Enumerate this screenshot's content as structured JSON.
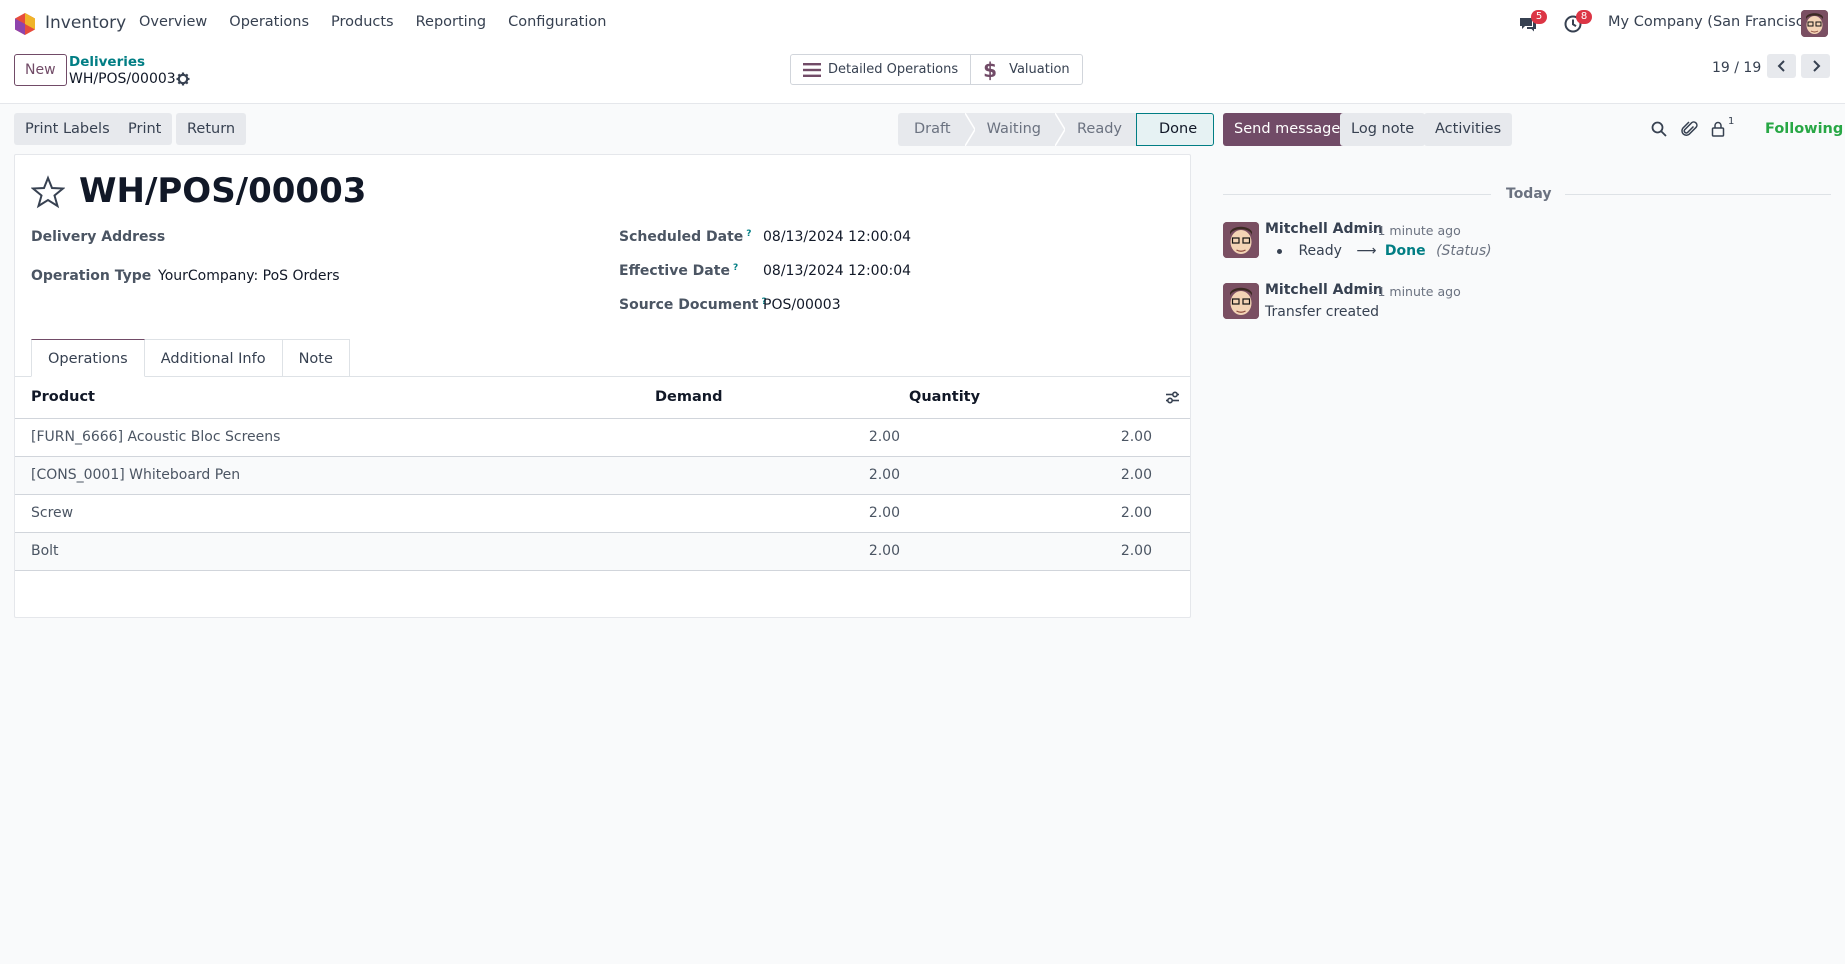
{
  "navbar": {
    "app_name": "Inventory",
    "menu": [
      "Overview",
      "Operations",
      "Products",
      "Reporting",
      "Configuration"
    ],
    "messages_badge": "5",
    "activities_badge": "8",
    "company": "My Company (San Francisco)"
  },
  "control_panel": {
    "new_label": "New",
    "breadcrumb_parent": "Deliveries",
    "breadcrumb_current": "WH/POS/00003",
    "smart_buttons": [
      "Detailed Operations",
      "Valuation"
    ],
    "pager": "19 / 19"
  },
  "actions": {
    "print_labels": "Print Labels",
    "print": "Print",
    "return": "Return"
  },
  "statusbar": {
    "steps": [
      "Draft",
      "Waiting",
      "Ready",
      "Done"
    ],
    "current": "Done"
  },
  "record": {
    "title": "WH/POS/00003",
    "delivery_address_label": "Delivery Address",
    "operation_type_label": "Operation Type",
    "operation_type_value": "YourCompany: PoS Orders",
    "scheduled_date_label": "Scheduled Date",
    "scheduled_date_value": "08/13/2024 12:00:04",
    "effective_date_label": "Effective Date",
    "effective_date_value": "08/13/2024 12:00:04",
    "source_document_label": "Source Document",
    "source_document_value": "POS/00003",
    "help_mark": "?"
  },
  "tabs": [
    "Operations",
    "Additional Info",
    "Note"
  ],
  "table": {
    "headers": {
      "product": "Product",
      "demand": "Demand",
      "quantity": "Quantity"
    },
    "rows": [
      {
        "product": "[FURN_6666] Acoustic Bloc Screens",
        "demand": "2.00",
        "quantity": "2.00"
      },
      {
        "product": "[CONS_0001] Whiteboard Pen",
        "demand": "2.00",
        "quantity": "2.00"
      },
      {
        "product": "Screw",
        "demand": "2.00",
        "quantity": "2.00"
      },
      {
        "product": "Bolt",
        "demand": "2.00",
        "quantity": "2.00"
      }
    ]
  },
  "chatter": {
    "send_message": "Send message",
    "log_note": "Log note",
    "activities": "Activities",
    "followers_count": "1",
    "following": "Following",
    "date_separator": "Today",
    "messages": [
      {
        "author": "Mitchell Admin",
        "time": "- 1 minute ago",
        "old_value": "Ready",
        "arrow": "⟶",
        "new_value": "Done",
        "field": "(Status)"
      },
      {
        "author": "Mitchell Admin",
        "time": "- 1 minute ago",
        "body": "Transfer created"
      }
    ]
  },
  "colors": {
    "brand": "#714b67",
    "link": "#017e84",
    "following": "#28a745",
    "badge": "#dc3545"
  }
}
